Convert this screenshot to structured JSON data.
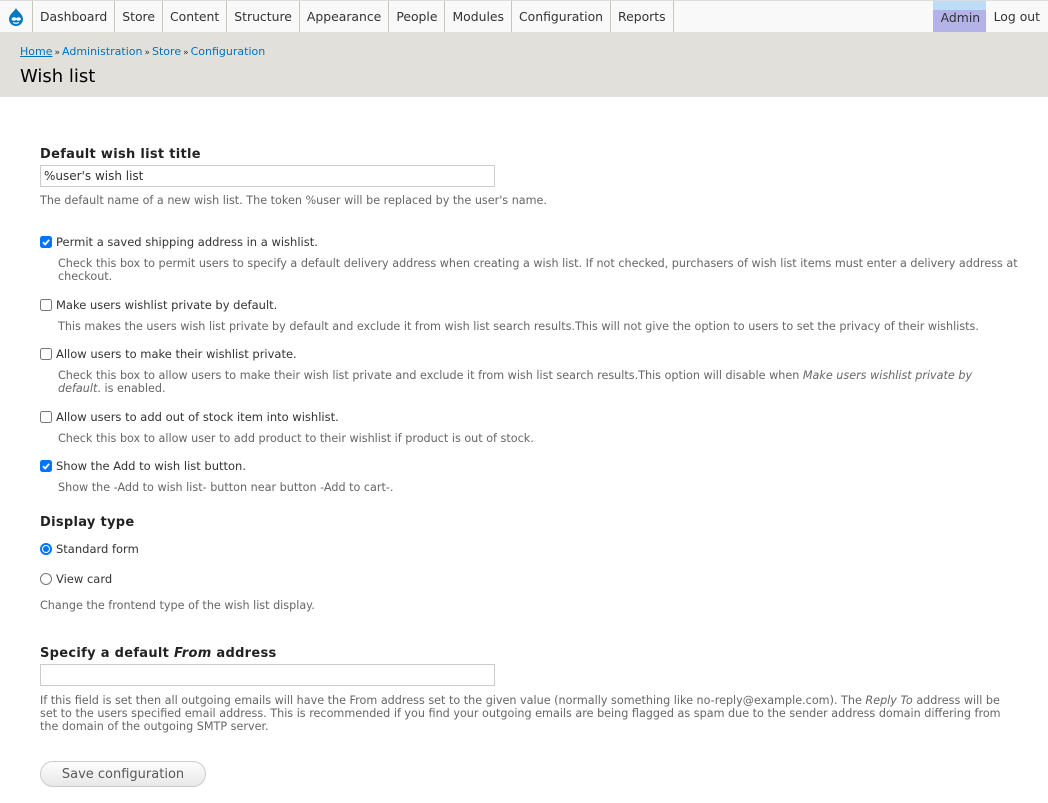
{
  "toolbar": {
    "menu": [
      "Dashboard",
      "Store",
      "Content",
      "Structure",
      "Appearance",
      "People",
      "Modules",
      "Configuration",
      "Reports"
    ],
    "user": "Admin",
    "logout": "Log out",
    "logo_icon": "drupal-drop-icon"
  },
  "breadcrumb": {
    "items": [
      "Home",
      "Administration",
      "Store",
      "Configuration"
    ],
    "separator": "»"
  },
  "page_title": "Wish list",
  "form": {
    "title_field": {
      "label": "Default wish list title",
      "value": "%user's wish list",
      "description": "The default name of a new wish list. The token %user will be replaced by the user's name."
    },
    "checkboxes": [
      {
        "label": "Permit a saved shipping address in a wishlist.",
        "checked": true,
        "description": "Check this box to permit users to specify a default delivery address when creating a wish list. If not checked, purchasers of wish list items must enter a delivery address at checkout."
      },
      {
        "label": "Make users wishlist private by default.",
        "checked": false,
        "description": "This makes the users wish list private by default and exclude it from wish list search results.This will not give the option to users to set the privacy of their wishlists."
      },
      {
        "label": "Allow users to make their wishlist private.",
        "checked": false,
        "description_pre": "Check this box to allow users to make their wish list private and exclude it from wish list search results.This option will disable when ",
        "description_em": "Make users wishlist private by default",
        "description_post": ". is enabled."
      },
      {
        "label": "Allow users to add out of stock item into wishlist.",
        "checked": false,
        "description": "Check this box to allow user to add product to their wishlist if product is out of stock."
      },
      {
        "label": "Show the Add to wish list button.",
        "checked": true,
        "description": "Show the -Add to wish list- button near button -Add to cart-."
      }
    ],
    "display_type": {
      "label": "Display type",
      "options": [
        {
          "label": "Standard form",
          "selected": true
        },
        {
          "label": "View card",
          "selected": false
        }
      ],
      "description": "Change the frontend type of the wish list display."
    },
    "from_field": {
      "label_pre": "Specify a default ",
      "label_em": "From",
      "label_post": " address",
      "value": "",
      "description_pre": "If this field is set then all outgoing emails will have the From address set to the given value (normally something like no-reply@example.com). The ",
      "description_em": "Reply To",
      "description_post": " address will be set to the users specified email address. This is recommended if you find your outgoing emails are being flagged as spam due to the sender address domain differing from the domain of the outgoing SMTP server."
    },
    "save_label": "Save configuration"
  },
  "colors": {
    "link": "#0074bd",
    "header_bg": "#e1e0da",
    "checkbox_accent": "#0075ff",
    "admin_tab_bg": "#b3b3e8"
  }
}
